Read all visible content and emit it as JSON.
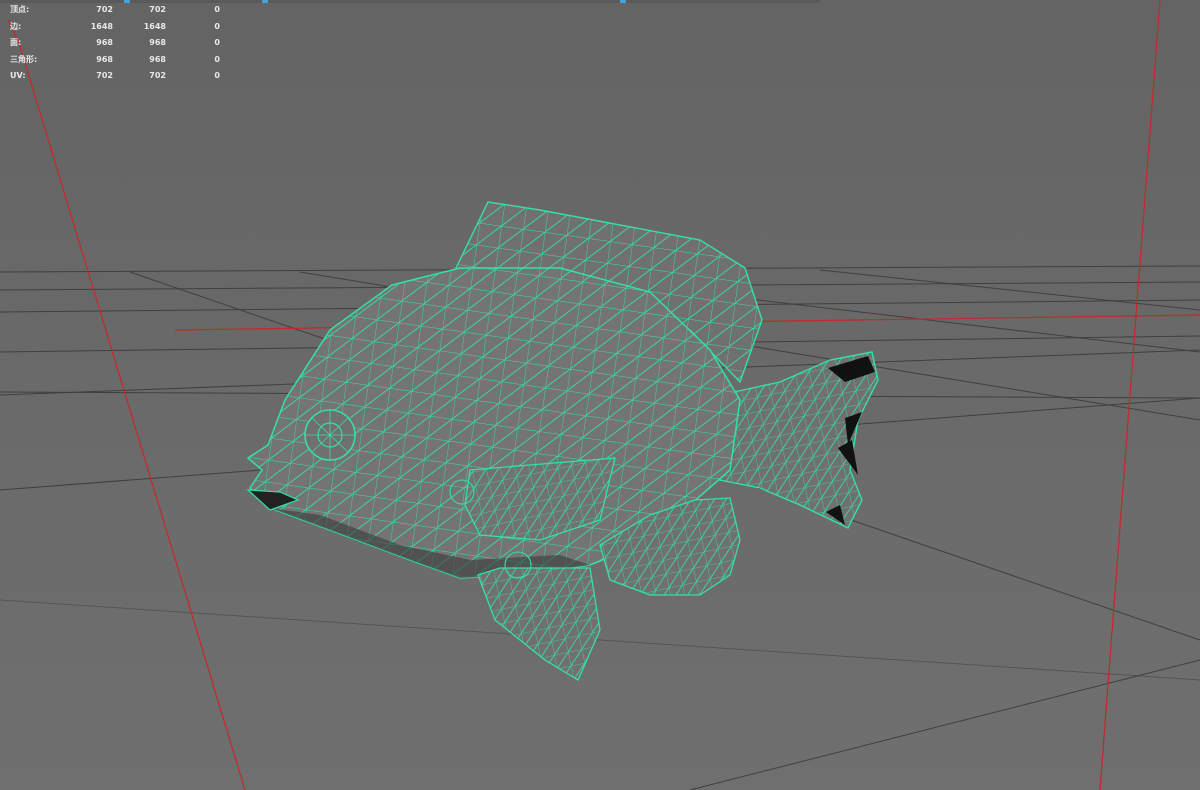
{
  "viewport": {
    "background_color": "#6b6b6b",
    "grid_color": "#3c3c3c",
    "axis_color": "#c62828",
    "wireframe_color": "#35e0a6",
    "mesh_fill_color": "#707070"
  },
  "hud": {
    "rows": [
      {
        "label": "顶点:",
        "v1": "702",
        "v2": "702",
        "v3": "0"
      },
      {
        "label": "边:",
        "v1": "1648",
        "v2": "1648",
        "v3": "0"
      },
      {
        "label": "面:",
        "v1": "968",
        "v2": "968",
        "v3": "0"
      },
      {
        "label": "三角形:",
        "v1": "968",
        "v2": "968",
        "v3": "0"
      },
      {
        "label": "UV:",
        "v1": "702",
        "v2": "702",
        "v3": "0"
      }
    ]
  },
  "model": {
    "icon": "fish-mesh-icon",
    "selected": true
  }
}
